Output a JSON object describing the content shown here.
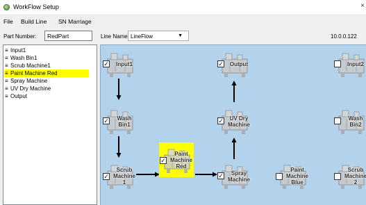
{
  "window": {
    "title": "WorkFlow Setup",
    "close_glyph": "×"
  },
  "menu": {
    "items": [
      "File",
      "Build Line",
      "SN Marriage"
    ]
  },
  "header": {
    "part_label": "Part Number:",
    "part_value": "RedPart",
    "line_label": "Line Name:",
    "line_value": "LineFlow",
    "ip": "10.0.0.122"
  },
  "sidebar": {
    "items": [
      {
        "label": "Input1",
        "selected": false
      },
      {
        "label": "Wash Bin1",
        "selected": false
      },
      {
        "label": "Scrub Machine1",
        "selected": false
      },
      {
        "label": "Paint Machine Red",
        "selected": true
      },
      {
        "label": "Spray Machine",
        "selected": false
      },
      {
        "label": "UV Dry Machine",
        "selected": false
      },
      {
        "label": "Output",
        "selected": false
      }
    ]
  },
  "stations": [
    {
      "id": "input1",
      "lines": [
        "Input1"
      ],
      "checked": true,
      "highlight": false
    },
    {
      "id": "output",
      "lines": [
        "Output"
      ],
      "checked": true,
      "highlight": false
    },
    {
      "id": "input2",
      "lines": [
        "Input2"
      ],
      "checked": false,
      "highlight": false
    },
    {
      "id": "wash-bin1",
      "lines": [
        "Wash",
        "Bin1"
      ],
      "checked": true,
      "highlight": false
    },
    {
      "id": "uv-dry",
      "lines": [
        "UV Dry",
        "Machine"
      ],
      "checked": true,
      "highlight": false
    },
    {
      "id": "wash-bin2",
      "lines": [
        "Wash",
        "Bin2"
      ],
      "checked": false,
      "highlight": false
    },
    {
      "id": "scrub1",
      "lines": [
        "Scrub",
        "Machine",
        "1"
      ],
      "checked": true,
      "highlight": false
    },
    {
      "id": "paint-red",
      "lines": [
        "Paint",
        "Machine",
        "Red"
      ],
      "checked": true,
      "highlight": true
    },
    {
      "id": "spray",
      "lines": [
        "Spray",
        "Machine"
      ],
      "checked": true,
      "highlight": false
    },
    {
      "id": "paint-blue",
      "lines": [
        "Paint",
        "Machine",
        "Blue"
      ],
      "checked": false,
      "highlight": false
    },
    {
      "id": "scrub2",
      "lines": [
        "Scrub",
        "Machine",
        "2"
      ],
      "checked": false,
      "highlight": false
    }
  ],
  "colors": {
    "canvas_bg": "#b3d2ec",
    "selection": "#ffff00",
    "arrow": "#000000"
  },
  "icons": {
    "app": "green-orb-icon",
    "list_item": "drag-handle-icon",
    "machine": "machine-icon",
    "arrow": "flow-arrow-icon"
  }
}
